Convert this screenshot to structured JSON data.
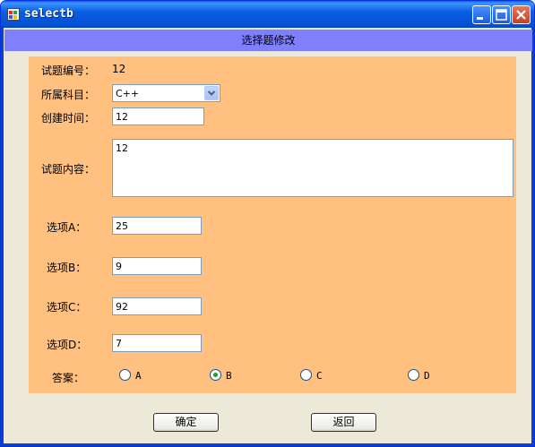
{
  "window": {
    "title": "selectb"
  },
  "header": {
    "title": "选择题修改"
  },
  "form": {
    "id_label": "试题编号：",
    "id_value": "12",
    "subject_label": "所属科目：",
    "subject_value": "C++",
    "created_label": "创建时间：",
    "created_value": "12",
    "content_label": "试题内容：",
    "content_value": "12",
    "option_a_label": "选项A：",
    "option_a_value": "25",
    "option_b_label": "选项B：",
    "option_b_value": "9",
    "option_c_label": "选项C：",
    "option_c_value": "92",
    "option_d_label": "选项D：",
    "option_d_value": "7",
    "answer_label": "答案：",
    "answers": [
      {
        "label": "A",
        "checked": false
      },
      {
        "label": "B",
        "checked": true
      },
      {
        "label": "C",
        "checked": false
      },
      {
        "label": "D",
        "checked": false
      }
    ]
  },
  "buttons": {
    "confirm": "确定",
    "back": "返回"
  },
  "colors": {
    "header": "#8080ff",
    "panel": "#ffc080",
    "titlebar": "#0552d6"
  }
}
